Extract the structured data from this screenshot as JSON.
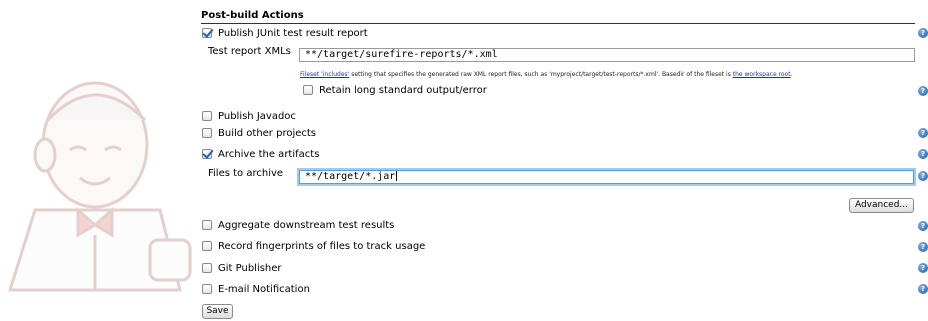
{
  "section": {
    "title": "Post-build Actions"
  },
  "junit": {
    "label": "Publish JUnit test result report",
    "checked": true,
    "xml_label": "Test report XMLs",
    "xml_value": "**/target/surefire-reports/*.xml",
    "desc_link1": "Fileset 'includes'",
    "desc_text": " setting that specifies the generated raw XML report files, such as 'myproject/target/test-reports/*.xml'. Basedir of the fileset is ",
    "desc_link2": "the workspace root",
    "desc_end": ".",
    "retain_label": "Retain long standard output/error",
    "retain_checked": false
  },
  "options": {
    "javadoc": "Publish Javadoc",
    "build_other": "Build other projects",
    "archive": "Archive the artifacts",
    "aggregate": "Aggregate downstream test results",
    "fingerprints": "Record fingerprints of files to track usage",
    "git": "Git Publisher",
    "email": "E-mail Notification"
  },
  "archive": {
    "files_label": "Files to archive",
    "files_value": "**/target/*.jar",
    "advanced_label": "Advanced..."
  },
  "help": {
    "glyph": "?"
  },
  "save_label": "Save",
  "icons": {
    "help": "help-icon",
    "mascot": "jenkins-mascot-icon"
  }
}
